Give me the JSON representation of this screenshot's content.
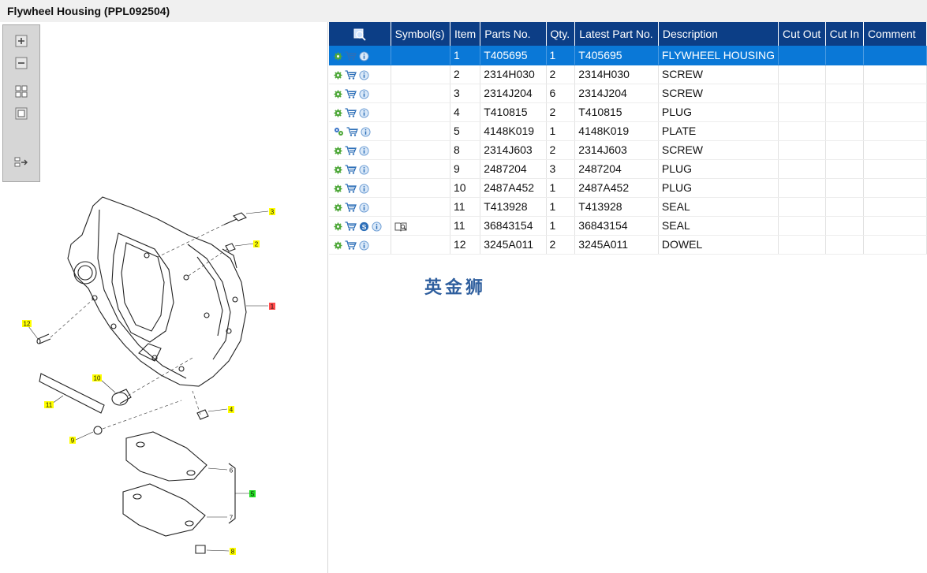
{
  "window": {
    "title": "Flywheel Housing (PPL092504)"
  },
  "toolbar": {
    "buttons": [
      {
        "icon": "zoom-in-icon"
      },
      {
        "icon": "zoom-out-icon"
      },
      {
        "icon": "fit-all-icon"
      },
      {
        "icon": "fit-page-icon"
      },
      {
        "icon": "export-icon"
      }
    ]
  },
  "table": {
    "columns": [
      "",
      "Symbol(s)",
      "Item",
      "Parts No.",
      "Qty.",
      "Latest Part No.",
      "Description",
      "Cut Out",
      "Cut In",
      "Comment"
    ],
    "rows": [
      {
        "icons": [
          "gear-icon",
          "cart-icon",
          "info-icon"
        ],
        "symbol": "",
        "item": "1",
        "part_no": "T405695",
        "qty": "1",
        "latest": "T405695",
        "desc": "FLYWHEEL HOUSING",
        "selected": true
      },
      {
        "icons": [
          "gear-icon",
          "cart-icon",
          "info-icon"
        ],
        "symbol": "",
        "item": "2",
        "part_no": "2314H030",
        "qty": "2",
        "latest": "2314H030",
        "desc": "SCREW",
        "selected": false
      },
      {
        "icons": [
          "gear-icon",
          "cart-icon",
          "info-icon"
        ],
        "symbol": "",
        "item": "3",
        "part_no": "2314J204",
        "qty": "6",
        "latest": "2314J204",
        "desc": "SCREW",
        "selected": false
      },
      {
        "icons": [
          "gear-icon",
          "cart-icon",
          "info-icon"
        ],
        "symbol": "",
        "item": "4",
        "part_no": "T410815",
        "qty": "2",
        "latest": "T410815",
        "desc": "PLUG",
        "selected": false
      },
      {
        "icons": [
          "gears-icon",
          "cart-icon",
          "info-icon"
        ],
        "symbol": "",
        "item": "5",
        "part_no": "4148K019",
        "qty": "1",
        "latest": "4148K019",
        "desc": "PLATE",
        "selected": false
      },
      {
        "icons": [
          "gear-icon",
          "cart-icon",
          "info-icon"
        ],
        "symbol": "",
        "item": "8",
        "part_no": "2314J603",
        "qty": "2",
        "latest": "2314J603",
        "desc": "SCREW",
        "selected": false
      },
      {
        "icons": [
          "gear-icon",
          "cart-icon",
          "info-icon"
        ],
        "symbol": "",
        "item": "9",
        "part_no": "2487204",
        "qty": "3",
        "latest": "2487204",
        "desc": "PLUG",
        "selected": false
      },
      {
        "icons": [
          "gear-icon",
          "cart-icon",
          "info-icon"
        ],
        "symbol": "",
        "item": "10",
        "part_no": "2487A452",
        "qty": "1",
        "latest": "2487A452",
        "desc": "PLUG",
        "selected": false
      },
      {
        "icons": [
          "gear-icon",
          "cart-icon",
          "info-icon"
        ],
        "symbol": "",
        "item": "11",
        "part_no": "T413928",
        "qty": "1",
        "latest": "T413928",
        "desc": "SEAL",
        "selected": false
      },
      {
        "icons": [
          "gear-icon",
          "cart-icon",
          "s-badge-icon",
          "info-icon"
        ],
        "symbol": "book-icon",
        "item": "11",
        "part_no": "36843154",
        "qty": "1",
        "latest": "36843154",
        "desc": "SEAL",
        "selected": false
      },
      {
        "icons": [
          "gear-icon",
          "cart-icon",
          "info-icon"
        ],
        "symbol": "",
        "item": "12",
        "part_no": "3245A011",
        "qty": "2",
        "latest": "3245A011",
        "desc": "DOWEL",
        "selected": false
      }
    ]
  },
  "watermark": "英金狮",
  "drawing": {
    "callouts": [
      {
        "label": "3",
        "color": "#ffff00"
      },
      {
        "label": "2",
        "color": "#ffff00"
      },
      {
        "label": "1",
        "color": "#ff4a4a"
      },
      {
        "label": "12",
        "color": "#ffff00"
      },
      {
        "label": "10",
        "color": "#ffff00"
      },
      {
        "label": "11",
        "color": "#ffff00"
      },
      {
        "label": "4",
        "color": "#ffff00"
      },
      {
        "label": "9",
        "color": "#ffff00"
      },
      {
        "label": "6",
        "color": "none"
      },
      {
        "label": "5",
        "color": "#22dd22"
      },
      {
        "label": "7",
        "color": "none"
      },
      {
        "label": "8",
        "color": "#ffff00"
      }
    ]
  }
}
